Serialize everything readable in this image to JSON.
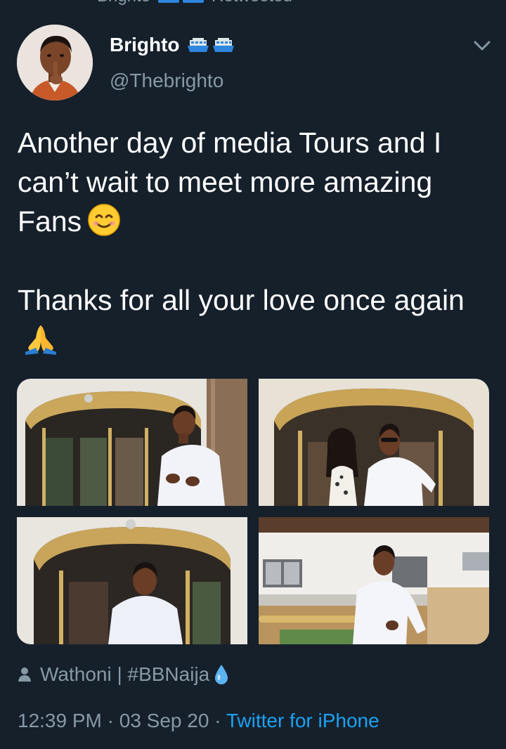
{
  "retweet": {
    "retweeter": "Brighto",
    "label": "Retweeted"
  },
  "author": {
    "display_name": "Brighto",
    "handle": "@Thebrighto",
    "name_emoji": [
      "passenger-ship-icon",
      "passenger-ship-icon"
    ]
  },
  "tweet": {
    "paragraph1": "Another day of media Tours and I can’t wait to meet more amazing Fans",
    "paragraph1_emoji": "smiling-face-icon",
    "paragraph2": "Thanks for all your love once again",
    "paragraph2_emoji": "folded-hands-icon"
  },
  "media": {
    "photos": [
      {
        "name": "photo-man-at-revolving-door"
      },
      {
        "name": "photo-couple-at-revolving-door"
      },
      {
        "name": "photo-man-sitting-at-revolving-door"
      },
      {
        "name": "photo-man-outside-building"
      }
    ]
  },
  "source": {
    "text": "Wathoni | #BBNaija",
    "icon": "person-icon",
    "trailing_icon": "droplet-icon"
  },
  "meta": {
    "time": "12:39 PM",
    "separator": " · ",
    "date": "03 Sep 20",
    "client": "Twitter for iPhone"
  },
  "colors": {
    "background": "#15202b",
    "text_primary": "#ffffff",
    "text_secondary": "#8899a6",
    "link": "#1da1f2"
  }
}
